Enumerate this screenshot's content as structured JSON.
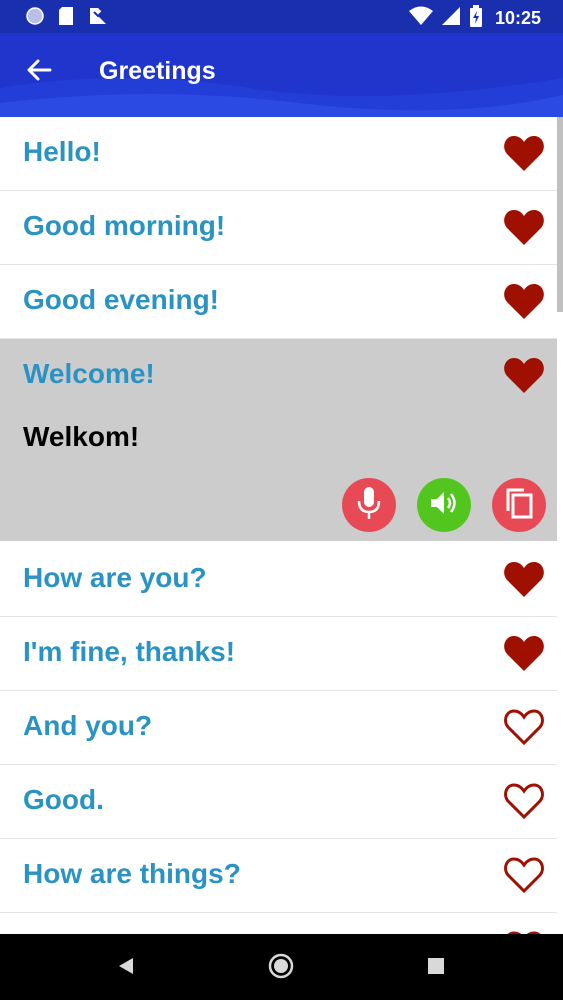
{
  "status_bar": {
    "time": "10:25",
    "icons": [
      "circle-icon",
      "sd-card-icon",
      "download-icon",
      "wifi-icon",
      "signal-icon",
      "battery-icon"
    ]
  },
  "app_bar": {
    "title": "Greetings",
    "back_icon": "arrow-left-icon"
  },
  "colors": {
    "primary": "#1f35cc",
    "phrase_text": "#2a93c4",
    "heart": "#a01000",
    "expanded_bg": "#cccccc",
    "mic_button": "#e84a55",
    "speaker_button": "#52c61f",
    "copy_button": "#e84a55"
  },
  "phrases": [
    {
      "text": "Hello!",
      "favorite": true
    },
    {
      "text": "Good morning!",
      "favorite": true
    },
    {
      "text": "Good evening!",
      "favorite": true
    },
    {
      "text": "Welcome!",
      "favorite": true,
      "translation": "Welkom!",
      "expanded": true
    },
    {
      "text": "How are you?",
      "favorite": true
    },
    {
      "text": "I'm fine, thanks!",
      "favorite": true
    },
    {
      "text": "And you?",
      "favorite": false
    },
    {
      "text": "Good.",
      "favorite": false
    },
    {
      "text": "How are things?",
      "favorite": false
    }
  ],
  "actions": [
    "mic-icon",
    "speaker-icon",
    "copy-icon"
  ],
  "nav_bar": [
    "back-triangle-icon",
    "home-circle-icon",
    "recents-square-icon"
  ]
}
